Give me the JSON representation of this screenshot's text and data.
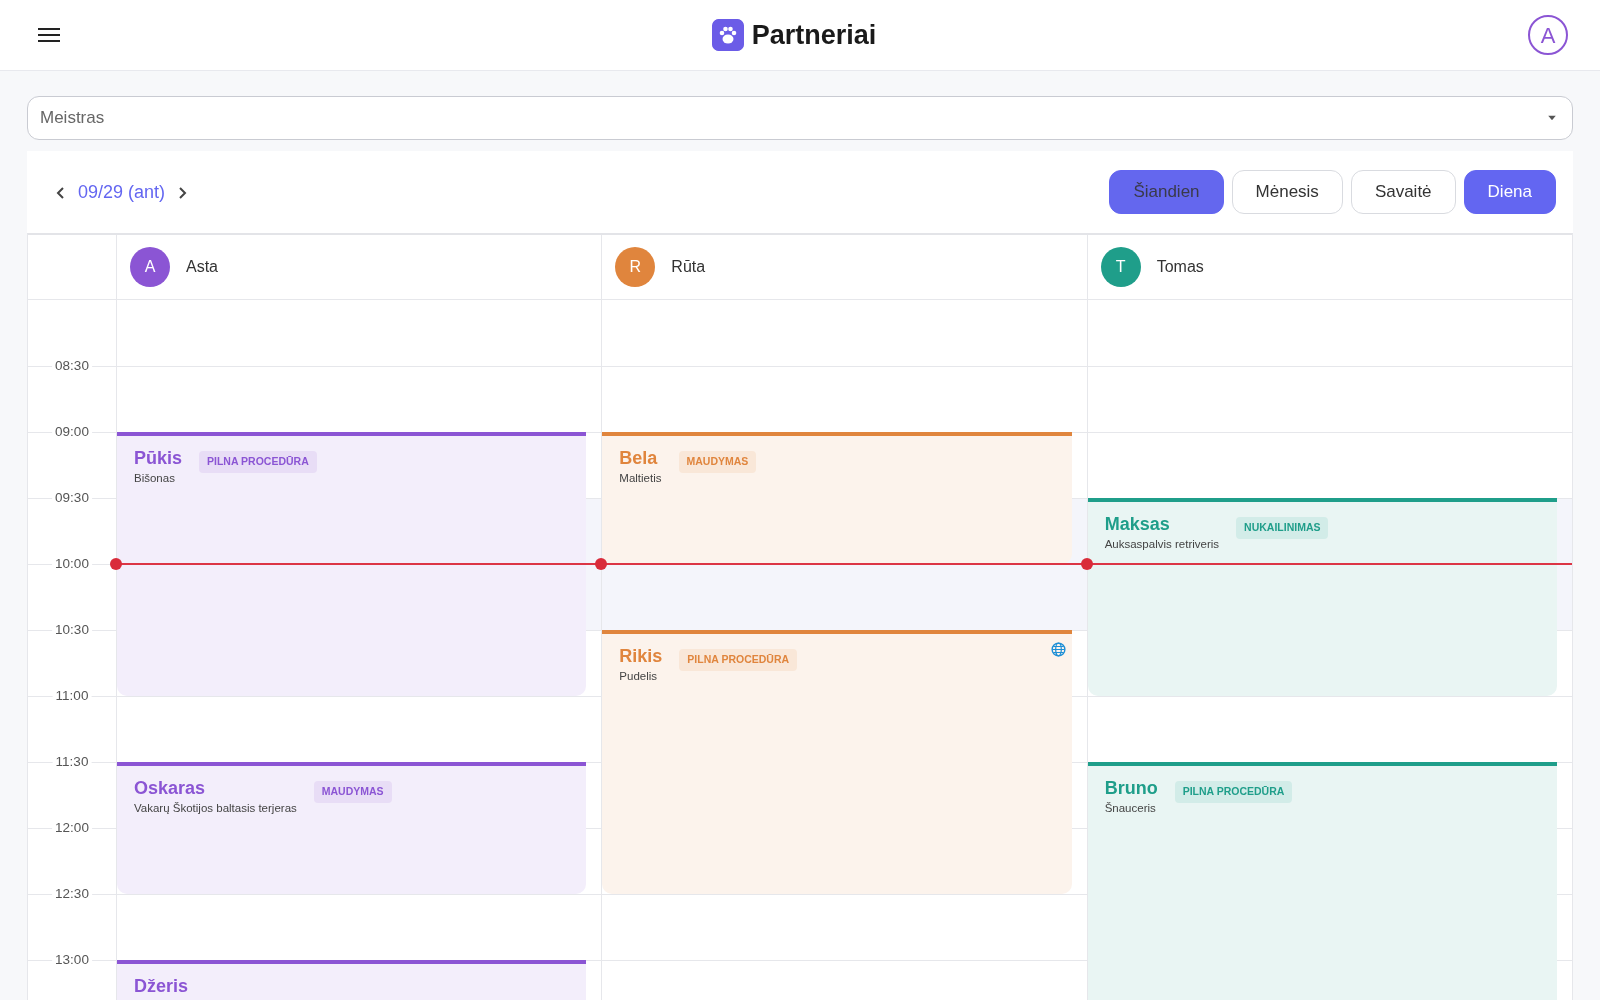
{
  "app_bar": {
    "title": "Partneriai",
    "user_initial": "A"
  },
  "master_select": {
    "placeholder": "Meistras"
  },
  "date_nav": {
    "label": "09/29 (ant)"
  },
  "today_button": {
    "label": "Šiandien",
    "disabled": true
  },
  "views": [
    {
      "label": "Mėnesis",
      "selected": false
    },
    {
      "label": "Savaitė",
      "selected": false
    },
    {
      "label": "Diena",
      "selected": true
    }
  ],
  "time_labels": [
    "08:30",
    "09:00",
    "09:30",
    "10:00",
    "10:30",
    "11:00",
    "11:30",
    "12:00",
    "12:30",
    "13:00"
  ],
  "staff": [
    {
      "name": "Asta",
      "initial": "A",
      "color": "#8b55d4",
      "appointments": [
        {
          "pet": "Pūkis",
          "breed": "Bišonas",
          "service": "PILNA PROCEDŪRA",
          "online": false
        },
        {
          "pet": "Oskaras",
          "breed": "Vakarų Škotijos baltasis terjeras",
          "service": "MAUDYMAS",
          "online": false
        },
        {
          "pet": "Džeris",
          "online": false
        }
      ]
    },
    {
      "name": "Rūta",
      "initial": "R",
      "color": "#e0853d",
      "appointments": [
        {
          "pet": "Bela",
          "breed": "Maltietis",
          "service": "MAUDYMAS",
          "online": false
        },
        {
          "pet": "Rikis",
          "breed": "Pudelis",
          "service": "PILNA PROCEDŪRA",
          "online": true
        }
      ]
    },
    {
      "name": "Tomas",
      "initial": "T",
      "color": "#1f9e8a",
      "appointments": [
        {
          "pet": "Maksas",
          "breed": "Auksaspalvis retriveris",
          "service": "NUKAILINIMAS",
          "online": false
        },
        {
          "pet": "Bruno",
          "breed": "Šnauceris",
          "service": "PILNA PROCEDŪRA",
          "online": false
        }
      ]
    }
  ]
}
